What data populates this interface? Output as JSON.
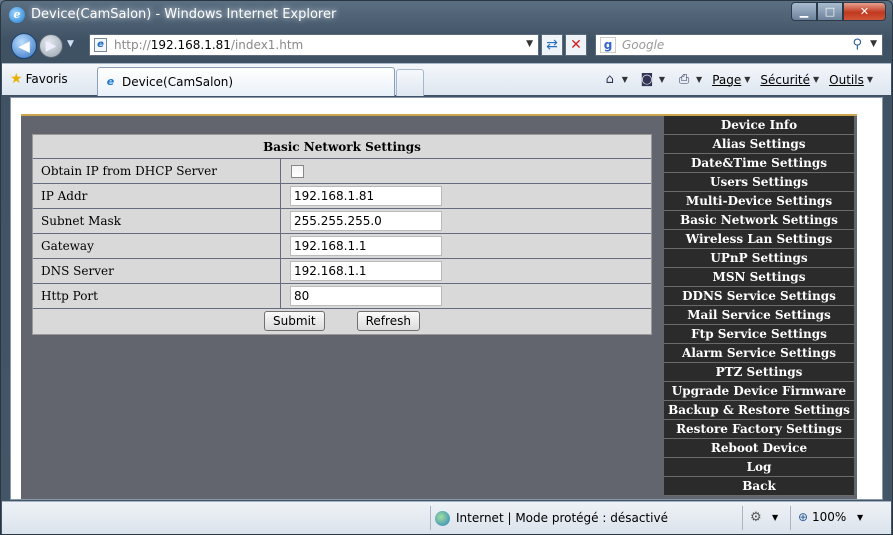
{
  "window": {
    "title": "Device(CamSalon) - Windows Internet Explorer",
    "min_glyph": "▁",
    "max_glyph": "□",
    "close_glyph": "✕"
  },
  "nav": {
    "back_glyph": "◀",
    "forward_glyph": "▶",
    "address_prefix": "http://",
    "address_host": "192.168.1.81",
    "address_path": "/index1.htm",
    "search_placeholder": "Google"
  },
  "toolbar": {
    "favorites_label": "Favoris",
    "tab_label": "Device(CamSalon)",
    "page_label": "Page",
    "security_label": "Sécurité",
    "tools_label": "Outils"
  },
  "settings": {
    "title": "Basic Network Settings",
    "rows": [
      {
        "label": "Obtain IP from DHCP Server",
        "type": "checkbox",
        "checked": false
      },
      {
        "label": "IP Addr",
        "type": "text",
        "value": "192.168.1.81"
      },
      {
        "label": "Subnet Mask",
        "type": "text",
        "value": "255.255.255.0"
      },
      {
        "label": "Gateway",
        "type": "text",
        "value": "192.168.1.1"
      },
      {
        "label": "DNS Server",
        "type": "text",
        "value": "192.168.1.1"
      },
      {
        "label": "Http Port",
        "type": "text",
        "value": "80"
      }
    ],
    "submit_label": "Submit",
    "refresh_label": "Refresh"
  },
  "menu": {
    "items": [
      "Device Info",
      "Alias Settings",
      "Date&Time Settings",
      "Users Settings",
      "Multi-Device Settings",
      "Basic Network Settings",
      "Wireless Lan Settings",
      "UPnP Settings",
      "MSN Settings",
      "DDNS Service Settings",
      "Mail Service Settings",
      "Ftp Service Settings",
      "Alarm Service Settings",
      "PTZ Settings",
      "Upgrade Device Firmware",
      "Backup & Restore Settings",
      "Restore Factory Settings",
      "Reboot Device",
      "Log",
      "Back"
    ]
  },
  "status": {
    "zone_text": "Internet | Mode protégé : désactivé",
    "zoom_text": "100%"
  },
  "colors": {
    "stage_bg": "#62656e",
    "menu_bg": "#2b2b2b",
    "form_bg": "#d9d9d9",
    "accent_border": "#c9a64b"
  }
}
